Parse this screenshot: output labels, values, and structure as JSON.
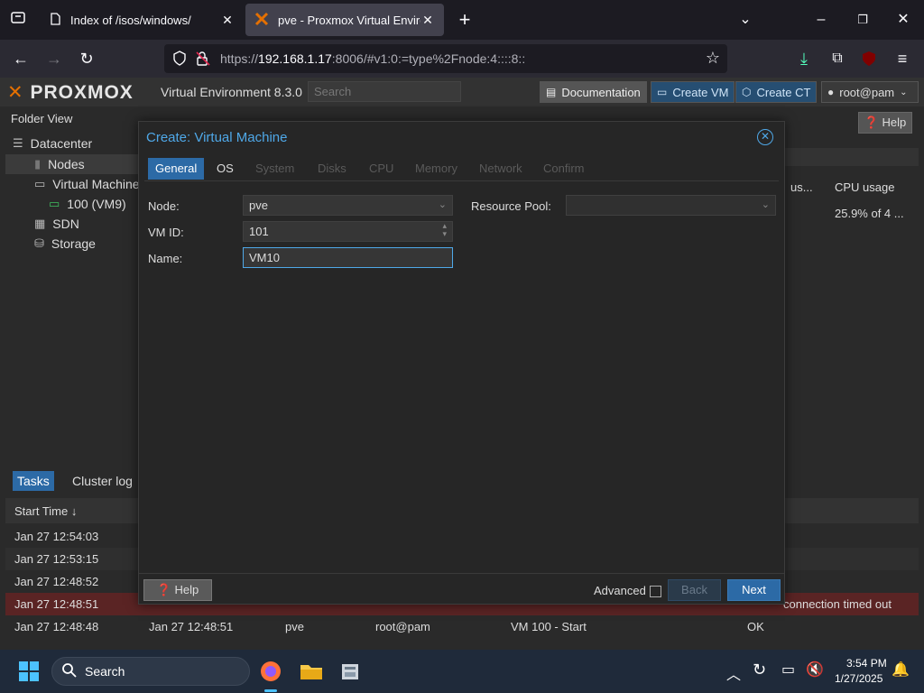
{
  "browser": {
    "tabs": [
      {
        "title": "Index of /isos/windows/"
      },
      {
        "title": "pve - Proxmox Virtual Environment"
      }
    ],
    "url_prefix": "https://",
    "url_host": "192.168.1.17",
    "url_rest": ":8006/#v1:0:=type%2Fnode:4::::8::"
  },
  "proxmox": {
    "logo": "PROXMOX",
    "version": "Virtual Environment 8.3.0",
    "search_placeholder": "Search",
    "header_buttons": {
      "documentation": "Documentation",
      "create_vm": "Create VM",
      "create_ct": "Create CT",
      "user": "root@pam"
    },
    "folder_view": "Folder View",
    "tree": [
      "Datacenter",
      "Nodes",
      "Virtual Machine",
      "100 (VM9)",
      "SDN",
      "Storage"
    ],
    "help": "Help",
    "right_cols": {
      "col1": "us...",
      "col2": "CPU usage",
      "cpu_value": "25.9% of 4 ..."
    }
  },
  "tasks": {
    "tabs": [
      "Tasks",
      "Cluster log"
    ],
    "start_time_header": "Start Time",
    "rows": [
      {
        "start": "Jan 27 12:54:03"
      },
      {
        "start": "Jan 27 12:53:15"
      },
      {
        "start": "Jan 27 12:48:52"
      },
      {
        "start": "Jan 27 12:48:51",
        "status": "connection timed out"
      },
      {
        "start": "Jan 27 12:48:48",
        "end": "Jan 27 12:48:51",
        "node": "pve",
        "user": "root@pam",
        "desc": "VM 100 - Start",
        "status": "OK"
      }
    ]
  },
  "dialog": {
    "title": "Create: Virtual Machine",
    "tabs": [
      "General",
      "OS",
      "System",
      "Disks",
      "CPU",
      "Memory",
      "Network",
      "Confirm"
    ],
    "labels": {
      "node": "Node:",
      "vmid": "VM ID:",
      "name": "Name:",
      "pool": "Resource Pool:"
    },
    "values": {
      "node": "pve",
      "vmid": "101",
      "name": "VM10",
      "pool": ""
    },
    "footer": {
      "help": "Help",
      "advanced": "Advanced",
      "back": "Back",
      "next": "Next"
    }
  },
  "taskbar": {
    "search": "Search",
    "time": "3:54 PM",
    "date": "1/27/2025"
  },
  "colors": {
    "accent": "#2c6aa6",
    "link": "#4fa8e8",
    "error_row": "#5a2424"
  }
}
